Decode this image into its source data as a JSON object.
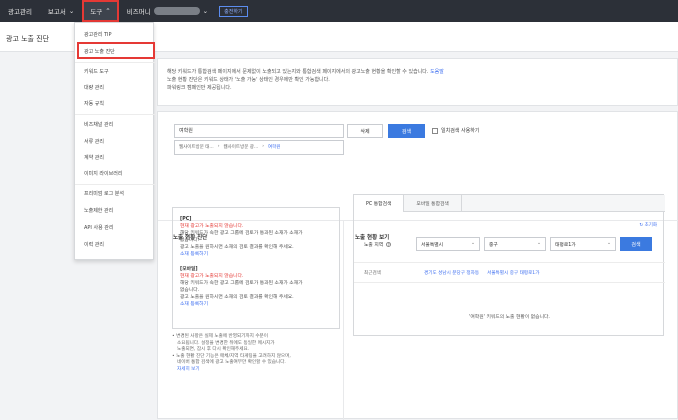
{
  "topbar": {
    "items": [
      "광고관리",
      "보고서",
      "도구",
      "비즈머니"
    ],
    "button": "충전하기"
  },
  "page_title": "광고 노출 진단",
  "dropdown": {
    "items": [
      "광고관리 TIP",
      "광고 노출 진단",
      "키워드 도구",
      "대량 관리",
      "자동 규칙",
      "비즈채널 관리",
      "서류 관리",
      "계약 관리",
      "이미지 라이브러리",
      "프리미엄 로그 분석",
      "노출제한 관리",
      "API 사용 관리",
      "이력 관리"
    ]
  },
  "notice": {
    "line1": "해당 키워드가 통합검색 페이지에서 문제없이 노출되고 있는지와 통합검색 페이지에서의 광고노출 현황을 확인할 수 있습니다.",
    "line1_link": "도움말",
    "line2": "노출 현황 진단은 키워드 상태가 '노출 가능' 상태인 경우에만 확인 가능합니다.",
    "line3": "파워링크 캠페인만 제공됩니다."
  },
  "search": {
    "value": "여학원",
    "delete_label": "삭제",
    "search_label": "검색",
    "checkbox_label": "일치검색 사용하기",
    "tags": [
      "웹사이트방문 태...",
      "웹사이트방문 광...",
      "여학원"
    ]
  },
  "diagnosis": {
    "title": "노출 현황 진단",
    "pc_header": "[PC]",
    "pc_status": "현재 광고가 노출되지 않습니다.",
    "pc_desc1": "해당 키워드가 속한 광고 그룹에 검토가 통과된 소재가 소재가",
    "pc_desc2": "없습니다.",
    "pc_desc3": "광고 노출을 원하시면 소재의 검토 결과를 확인해 주세요.",
    "pc_link": "소재 등록하기",
    "mobile_header": "[모바일]",
    "mobile_status": "현재 광고가 노출되지 않습니다.",
    "mobile_desc1": "해당 키워드가 속한 광고 그룹에 검토가 통과된 소재가 소재가",
    "mobile_desc2": "없습니다.",
    "mobile_desc3": "광고 노출을 원하시면 소재의 검토 결과를 확인해 주세요.",
    "mobile_link": "소재 등록하기",
    "note1a": "• 변경된 사항은 실제 노출에 반영되기까지 수분이",
    "note1b": "소요됩니다. 설정을 변경한 뒤에도 동일한 메시지가",
    "note1c": "노출되면, 잠시 후 다시 확인해주세요.",
    "note2a": "• 노출 현황 진단 기능은 매체/지역 타게팅을 고려하지 않으며,",
    "note2b": "네이버 통합 검색에 광고 노출여부만 확인할 수 있습니다.",
    "note2_link": "자세히 보기"
  },
  "status": {
    "title": "노출 현황 보기",
    "tabs": [
      "PC 통합검색",
      "모바일 통합검색"
    ],
    "reset": "초기화",
    "region_label": "노출 지역",
    "selects": [
      "서울특별시",
      "중구",
      "태평로1가"
    ],
    "check_label": "검색",
    "recent_label": "최근검색",
    "recent_items": [
      "경기도 성남시 분당구 정자동",
      "서울특별시 중구 태평로1가"
    ],
    "empty_message": "'여학원' 키워드의 노출 현황이 없습니다."
  }
}
